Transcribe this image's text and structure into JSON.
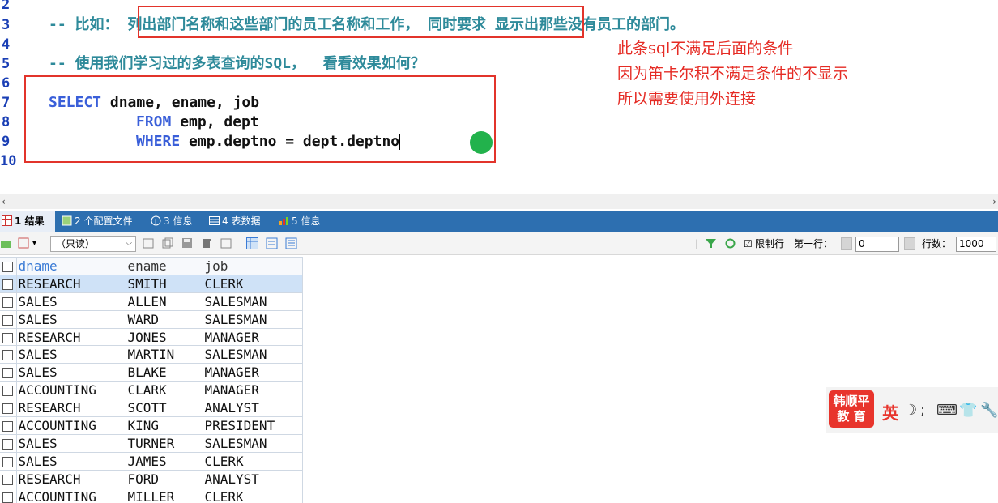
{
  "editor": {
    "lines": [
      {
        "num": "2",
        "text": ""
      },
      {
        "num": "3",
        "text": "-- 比如： 列出部门名称和这些部门的员工名称和工作， 同时要求 显示出那些没有员工的部门。"
      },
      {
        "num": "4",
        "text": ""
      },
      {
        "num": "5",
        "text": "-- 使用我们学习过的多表查询的SQL，  看看效果如何？"
      },
      {
        "num": "6",
        "text": ""
      },
      {
        "num": "7",
        "select_kw": "SELECT",
        "select_rest": "dname, ename, job"
      },
      {
        "num": "8",
        "from_kw": "FROM",
        "from_rest": "emp, dept"
      },
      {
        "num": "9",
        "where_kw": "WHERE",
        "where_rest": "emp.deptno = dept.deptno"
      },
      {
        "num": "10",
        "text": ""
      }
    ],
    "annotation": [
      "此条sql不满足后面的条件",
      "因为笛卡尔积不满足条件的不显示",
      "所以需要使用外连接"
    ]
  },
  "tabs": [
    {
      "label": "1 结果",
      "icon": "grid-icon"
    },
    {
      "label": "2 个配置文件",
      "icon": "profile-icon"
    },
    {
      "label": "3 信息",
      "icon": "info-icon"
    },
    {
      "label": "4 表数据",
      "icon": "table-icon"
    },
    {
      "label": "5 信息",
      "icon": "chart-icon"
    }
  ],
  "toolbar": {
    "mode_select": "（只读）",
    "limit_rows_label": "限制行",
    "first_row_label": "第一行：",
    "first_row_value": "0",
    "row_count_label": "行数：",
    "row_count_value": "1000"
  },
  "grid": {
    "columns": [
      "dname",
      "ename",
      "job"
    ],
    "rows": [
      [
        "RESEARCH",
        "SMITH",
        "CLERK"
      ],
      [
        "SALES",
        "ALLEN",
        "SALESMAN"
      ],
      [
        "SALES",
        "WARD",
        "SALESMAN"
      ],
      [
        "RESEARCH",
        "JONES",
        "MANAGER"
      ],
      [
        "SALES",
        "MARTIN",
        "SALESMAN"
      ],
      [
        "SALES",
        "BLAKE",
        "MANAGER"
      ],
      [
        "ACCOUNTING",
        "CLARK",
        "MANAGER"
      ],
      [
        "RESEARCH",
        "SCOTT",
        "ANALYST"
      ],
      [
        "ACCOUNTING",
        "KING",
        "PRESIDENT"
      ],
      [
        "SALES",
        "TURNER",
        "SALESMAN"
      ],
      [
        "SALES",
        "JAMES",
        "CLERK"
      ],
      [
        "RESEARCH",
        "FORD",
        "ANALYST"
      ],
      [
        "ACCOUNTING",
        "MILLER",
        "CLERK"
      ]
    ]
  },
  "watermark": {
    "logo_line1": "韩顺平",
    "logo_line2": "教 育",
    "ime_label": "英"
  },
  "colors": {
    "accent_red": "#e2342b",
    "tab_bar": "#2d6fb0",
    "keyword": "#3a5fd9",
    "comment": "#2e8a9a"
  }
}
